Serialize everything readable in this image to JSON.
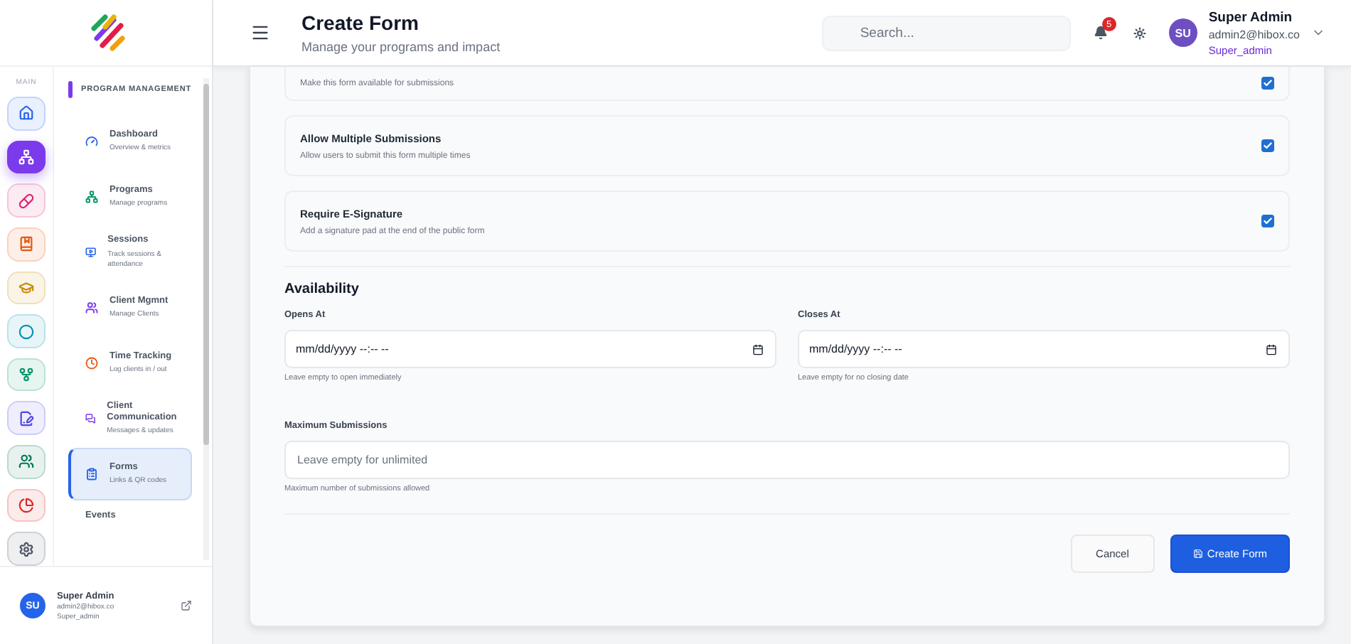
{
  "rail": {
    "label": "MAIN",
    "items": [
      {
        "kind": "home",
        "color": "#2563eb",
        "selected": false
      },
      {
        "kind": "network",
        "color": "#7c3aed",
        "selected": true
      },
      {
        "kind": "pill",
        "color": "#db2777",
        "selected": false
      },
      {
        "kind": "book",
        "color": "#ea580c",
        "selected": false
      },
      {
        "kind": "cap",
        "color": "#ca8a04",
        "selected": false
      },
      {
        "kind": "dot",
        "color": "#0891b2",
        "selected": false
      },
      {
        "kind": "fork",
        "color": "#059669",
        "selected": false
      },
      {
        "kind": "doc",
        "color": "#4f46e5",
        "selected": false
      },
      {
        "kind": "users",
        "color": "#047857",
        "selected": false
      },
      {
        "kind": "pie",
        "color": "#dc2626",
        "selected": false
      },
      {
        "kind": "gear",
        "color": "#4b5563",
        "selected": false
      }
    ]
  },
  "nav": {
    "heading": "PROGRAM MANAGEMENT",
    "items": [
      {
        "kind": "gauge",
        "title": "Dashboard",
        "subtitle": "Overview & metrics",
        "selected": false
      },
      {
        "kind": "network",
        "title": "Programs",
        "subtitle": "Manage programs",
        "selected": false
      },
      {
        "kind": "screen",
        "title": "Sessions",
        "subtitle": "Track sessions & attendance",
        "selected": false
      },
      {
        "kind": "users",
        "title": "Client Mgmnt",
        "subtitle": "Manage Clients",
        "selected": false
      },
      {
        "kind": "clock",
        "title": "Time Tracking",
        "subtitle": "Log clients in / out",
        "selected": false
      },
      {
        "kind": "chat",
        "title": "Client Communication",
        "subtitle": "Messages & updates",
        "selected": false
      },
      {
        "kind": "clipboard",
        "title": "Forms",
        "subtitle": "Links & QR codes",
        "selected": true
      },
      {
        "kind": "none",
        "title": "Events",
        "selected": false
      }
    ]
  },
  "sidebar_user": {
    "initials": "SU",
    "name": "Super Admin",
    "email": "admin2@hibox.co",
    "role": "Super_admin"
  },
  "header": {
    "title": "Create Form",
    "subtitle": "Manage your programs and impact",
    "search": {
      "placeholder": "Search..."
    },
    "notifications": "5",
    "user": {
      "initials": "SU",
      "name": "Super Admin",
      "email": "admin2@hibox.co",
      "role": "Super_admin"
    }
  },
  "toggles": [
    {
      "description": "Make this form available for submissions",
      "checked": true
    },
    {
      "title": "Allow Multiple Submissions",
      "description": "Allow users to submit this form multiple times",
      "checked": true
    },
    {
      "title": "Require E-Signature",
      "description": "Add a signature pad at the end of the public form",
      "checked": true
    }
  ],
  "availability": {
    "heading": "Availability",
    "opens": {
      "label": "Opens At",
      "value": "mm/dd/yyyy --:-- --",
      "hint": "Leave empty to open immediately"
    },
    "closes": {
      "label": "Closes At",
      "value": "mm/dd/yyyy --:-- --",
      "hint": "Leave empty for no closing date"
    },
    "max": {
      "label": "Maximum Submissions",
      "placeholder": "Leave empty for unlimited",
      "hint": "Maximum number of submissions allowed"
    }
  },
  "buttons": {
    "cancel": "Cancel",
    "submit": "Create Form"
  }
}
